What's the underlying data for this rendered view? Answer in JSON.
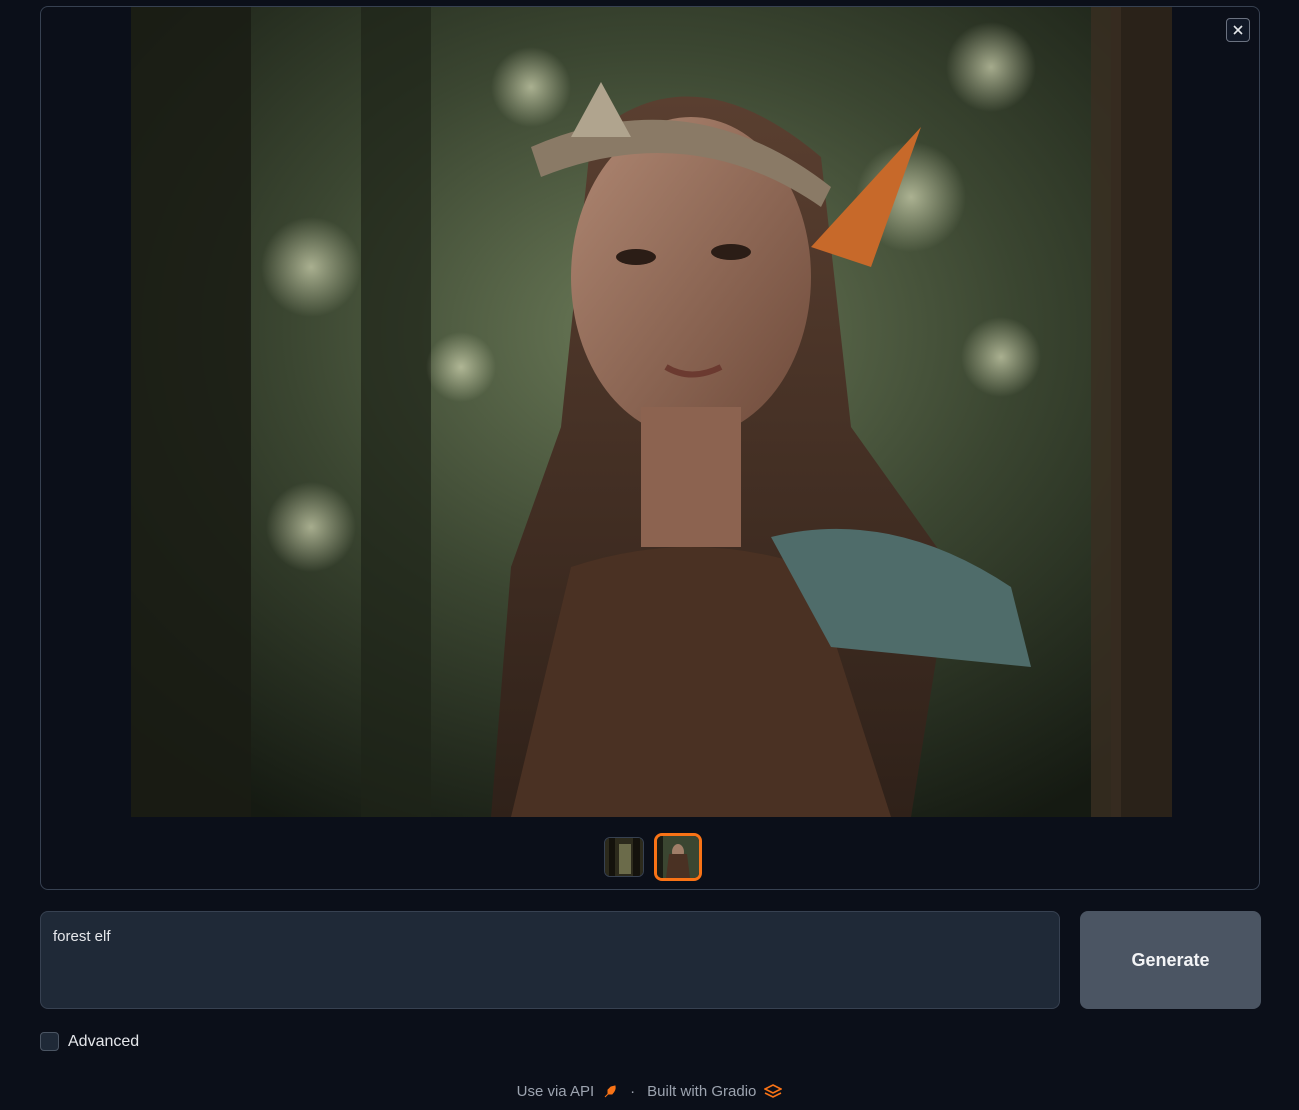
{
  "gallery": {
    "close_label": "×",
    "thumbnails": [
      {
        "alt": "forest scene thumbnail",
        "selected": false
      },
      {
        "alt": "forest elf thumbnail",
        "selected": true
      }
    ]
  },
  "prompt": {
    "value": "forest elf"
  },
  "generate_button": {
    "label": "Generate"
  },
  "advanced": {
    "label": "Advanced",
    "checked": false
  },
  "footer": {
    "api_label": "Use via API",
    "separator": "·",
    "built_label": "Built with Gradio"
  },
  "colors": {
    "accent": "#f97316",
    "background": "#0b0f19",
    "button": "#4b5563"
  }
}
